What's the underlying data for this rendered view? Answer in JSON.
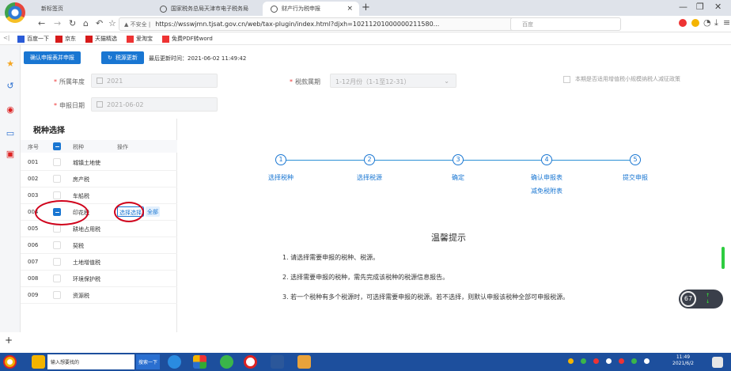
{
  "browser": {
    "tabs": [
      {
        "label": "新标签页"
      },
      {
        "label": "国家税务总局天津市电子税务局"
      },
      {
        "label": "财产行为税申报"
      }
    ],
    "url_warning": "▲ 不安全 |",
    "url": "https://wsswjmn.tjsat.gov.cn/web/tax-plugin/index.html?djxh=10211201000000211580...",
    "search_engine": "百度",
    "bookmarks": [
      "百度一下",
      "京东",
      "天猫精选",
      "爱淘宝",
      "免费PDF转word"
    ]
  },
  "toolbar": {
    "confirm_label": "确认申报表并申报",
    "refresh_label": "税源更新",
    "update_time": "最后更新时间：2021-06-02 11:49:42"
  },
  "form": {
    "year_label": "所属年度",
    "year_value": "2021",
    "period_label": "税款属期",
    "period_value": "1-12月份（1-1至12-31）",
    "date_label": "申报日期",
    "date_value": "2021-06-02",
    "checkbox_label": "本期是否适用增值税小规模纳税人减征政策"
  },
  "tax_panel": {
    "title": "税种选择",
    "headers": [
      "序号",
      "税种",
      "操作"
    ],
    "select_label": "选择选择",
    "all_label": "全部",
    "rows": [
      {
        "no": "001",
        "name": "城镇土地使",
        "checked": false
      },
      {
        "no": "002",
        "name": "房产税",
        "checked": false
      },
      {
        "no": "003",
        "name": "车船税",
        "checked": false
      },
      {
        "no": "004",
        "name": "印花税",
        "checked": true
      },
      {
        "no": "005",
        "name": "耕地占用税",
        "checked": false
      },
      {
        "no": "006",
        "name": "契税",
        "checked": false
      },
      {
        "no": "007",
        "name": "土地增值税",
        "checked": false
      },
      {
        "no": "008",
        "name": "环境保护税",
        "checked": false
      },
      {
        "no": "009",
        "name": "资源税",
        "checked": false
      }
    ]
  },
  "steps": [
    {
      "num": "1",
      "label": "选择税种"
    },
    {
      "num": "2",
      "label": "选择税源"
    },
    {
      "num": "3",
      "label": "确定"
    },
    {
      "num": "4",
      "label": "确认申报表",
      "sub": "减免税附表"
    },
    {
      "num": "5",
      "label": "提交申报"
    }
  ],
  "tips": {
    "title": "温馨提示",
    "items": [
      "1. 请选择需要申报的税种、税源。",
      "2. 选择需要申报的税种，需先完成该税种的税源信息报告。",
      "3. 若一个税种有多个税源时，可选择需要申报的税源。若不选择，则默认申报该税种全部可申报税源。"
    ]
  },
  "widget": {
    "speed": "67"
  },
  "taskbar": {
    "search_label": "输入想要找的",
    "search_btn": "搜索一下",
    "time": "11:49",
    "date": "2021/6/2"
  }
}
